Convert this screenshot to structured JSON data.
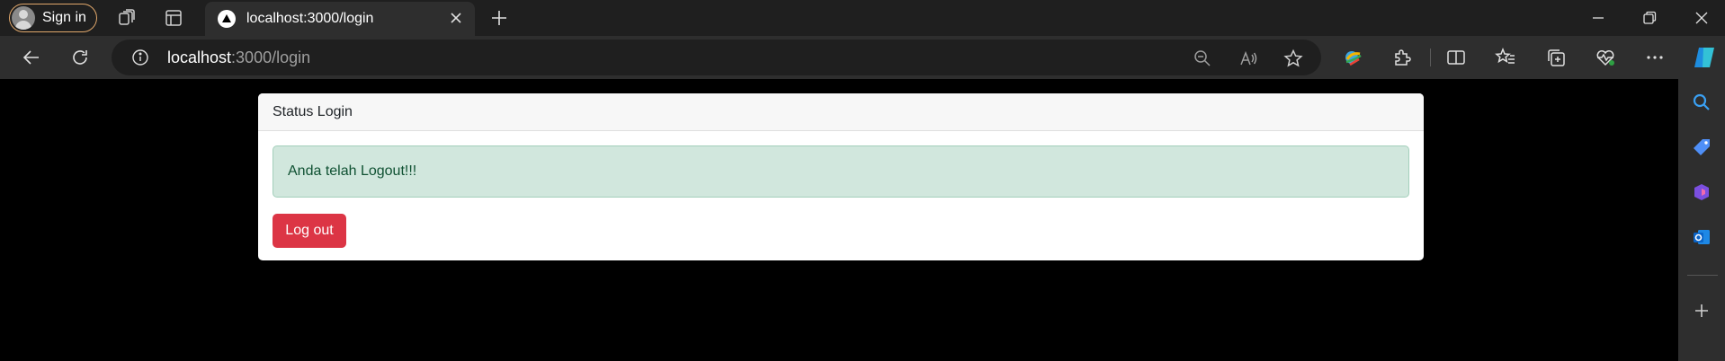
{
  "browser": {
    "sign_in_label": "Sign in",
    "tab": {
      "title": "localhost:3000/login"
    },
    "address": {
      "host": "localhost",
      "path": ":3000/login"
    },
    "icons": {
      "tabbar": [
        "workspaces-icon",
        "tab-actions-icon",
        "new-tab-icon"
      ],
      "window": [
        "minimize-icon",
        "restore-icon",
        "close-window-icon"
      ],
      "toolbar": [
        "back-icon",
        "refresh-icon",
        "zoom-out-icon",
        "read-aloud-icon",
        "favorite-star-icon",
        "color-extension-icon",
        "extensions-icon",
        "split-screen-icon",
        "favorites-icon",
        "collections-icon",
        "browser-essentials-icon",
        "more-menu-icon",
        "copilot-icon"
      ],
      "sidebar": [
        "search-icon",
        "shopping-icon",
        "office-icon",
        "outlook-icon",
        "add-icon"
      ]
    }
  },
  "page": {
    "card_header": "Status Login",
    "alert_text": "Anda telah Logout!!!",
    "logout_button": "Log out",
    "colors": {
      "alert_bg": "#d1e7dd",
      "alert_text": "#0f5132",
      "button": "#dc3545"
    }
  }
}
